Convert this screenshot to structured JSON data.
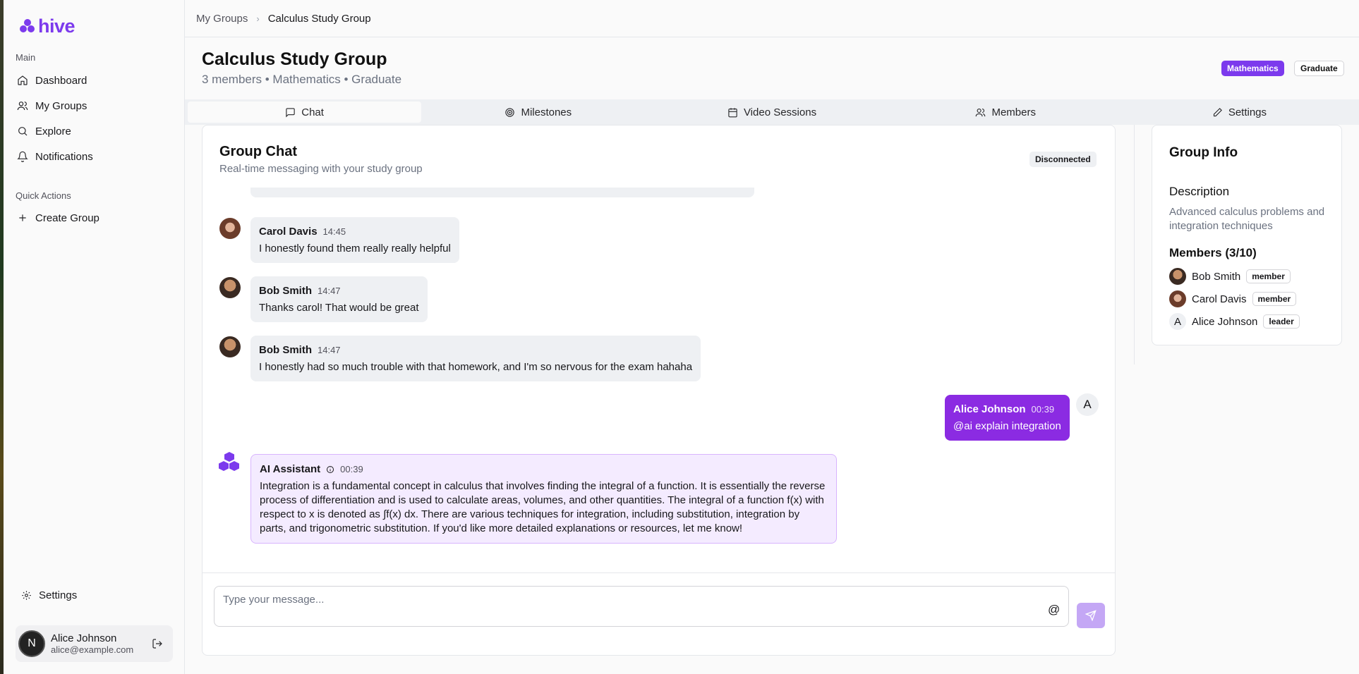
{
  "brand": {
    "name": "hive",
    "accent": "#7c3aed"
  },
  "sidebar": {
    "section_main": "Main",
    "items": [
      {
        "label": "Dashboard",
        "icon": "home-icon"
      },
      {
        "label": "My Groups",
        "icon": "users-icon"
      },
      {
        "label": "Explore",
        "icon": "search-icon"
      },
      {
        "label": "Notifications",
        "icon": "bell-icon"
      }
    ],
    "section_quick": "Quick Actions",
    "create_group": "Create Group",
    "settings": "Settings",
    "user": {
      "initial": "N",
      "name": "Alice Johnson",
      "email": "alice@example.com"
    }
  },
  "breadcrumb": {
    "parent": "My Groups",
    "current": "Calculus Study Group"
  },
  "group": {
    "title": "Calculus Study Group",
    "subtitle": "3 members • Mathematics • Graduate",
    "badges": [
      "Mathematics",
      "Graduate"
    ]
  },
  "tabs": [
    {
      "label": "Chat",
      "icon": "message-square-icon",
      "active": true
    },
    {
      "label": "Milestones",
      "icon": "target-icon",
      "active": false
    },
    {
      "label": "Video Sessions",
      "icon": "calendar-icon",
      "active": false
    },
    {
      "label": "Members",
      "icon": "users-icon",
      "active": false
    },
    {
      "label": "Settings",
      "icon": "pencil-icon",
      "active": false
    }
  ],
  "chat": {
    "title": "Group Chat",
    "subtitle": "Real-time messaging with your study group",
    "status": "Disconnected",
    "messages": [
      {
        "name": "Carol Davis",
        "time": "14:45",
        "text": "I honestly found them really really helpful"
      },
      {
        "name": "Bob Smith",
        "time": "14:47",
        "text": "Thanks carol! That would be great"
      },
      {
        "name": "Bob Smith",
        "time": "14:47",
        "text": "I honestly had so much trouble with that homework, and I'm so nervous for the exam hahaha"
      },
      {
        "name": "Alice Johnson",
        "time": "00:39",
        "text": "@ai explain integration",
        "avatar": "A"
      },
      {
        "name": "AI Assistant",
        "time": "00:39",
        "text": "Integration is a fundamental concept in calculus that involves finding the integral of a function. It is essentially the reverse process of differentiation and is used to calculate areas, volumes, and other quantities. The integral of a function f(x) with respect to x is denoted as ∫f(x) dx. There are various techniques for integration, including substitution, integration by parts, and trigonometric substitution. If you'd like more detailed explanations or resources, let me know!"
      }
    ],
    "composer": {
      "placeholder": "Type your message...",
      "value": "",
      "mention": "@"
    }
  },
  "group_info": {
    "title": "Group Info",
    "description_label": "Description",
    "description": "Advanced calculus problems and integration techniques",
    "members_label": "Members (3/10)",
    "members": [
      {
        "name": "Bob Smith",
        "role": "member"
      },
      {
        "name": "Carol Davis",
        "role": "member"
      },
      {
        "name": "Alice Johnson",
        "role": "leader",
        "initial": "A"
      }
    ]
  }
}
